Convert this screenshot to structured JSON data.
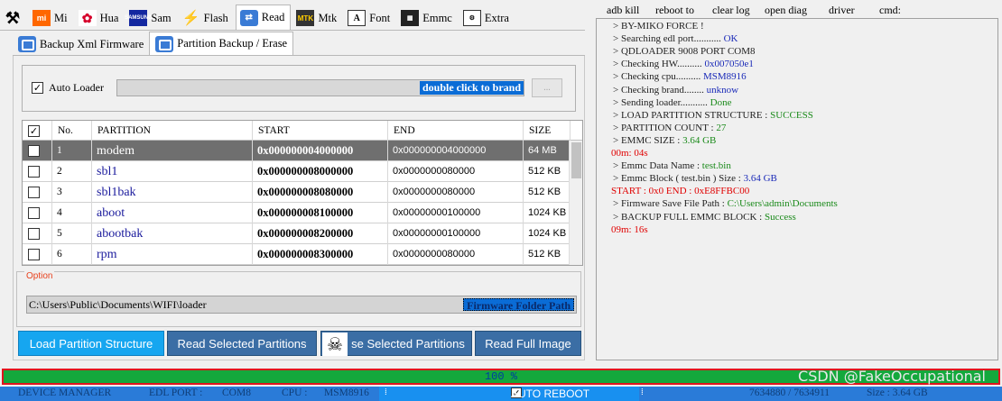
{
  "brand_tabs": [
    {
      "label": "",
      "icon": "tools-icon"
    },
    {
      "label": "Mi",
      "icon": "mi-icon"
    },
    {
      "label": "Hua",
      "icon": "huawei-icon"
    },
    {
      "label": "Sam",
      "icon": "samsung-icon"
    },
    {
      "label": "Flash",
      "icon": "flash-icon"
    },
    {
      "label": "Read",
      "icon": "read-icon",
      "active": true
    },
    {
      "label": "Mtk",
      "icon": "mtk-icon"
    },
    {
      "label": "Font",
      "icon": "font-icon"
    },
    {
      "label": "Emmc",
      "icon": "emmc-icon"
    },
    {
      "label": "Extra",
      "icon": "extra-icon"
    }
  ],
  "sub_tabs": [
    {
      "label": "Backup Xml Firmware"
    },
    {
      "label": "Partition Backup / Erase",
      "active": true
    }
  ],
  "loader": {
    "checkbox_label": "Auto Loader",
    "checked": true,
    "hint": "double click to brand",
    "button_label": "..."
  },
  "table": {
    "headers": [
      "No.",
      "PARTITION",
      "START",
      "END",
      "SIZE"
    ],
    "rows": [
      {
        "no": "1",
        "name": "modem",
        "start": "0x000000004000000",
        "end": "0x000000004000000",
        "size": "64 MB",
        "selected": true
      },
      {
        "no": "2",
        "name": "sbl1",
        "start": "0x000000008000000",
        "end": "0x0000000080000",
        "size": "512 KB"
      },
      {
        "no": "3",
        "name": "sbl1bak",
        "start": "0x000000008080000",
        "end": "0x0000000080000",
        "size": "512 KB"
      },
      {
        "no": "4",
        "name": "aboot",
        "start": "0x000000008100000",
        "end": "0x00000000100000",
        "size": "1024 KB"
      },
      {
        "no": "5",
        "name": "abootbak",
        "start": "0x000000008200000",
        "end": "0x00000000100000",
        "size": "1024 KB"
      },
      {
        "no": "6",
        "name": "rpm",
        "start": "0x000000008300000",
        "end": "0x0000000080000",
        "size": "512 KB"
      }
    ]
  },
  "option": {
    "label": "Option",
    "path": "C:\\Users\\Public\\Documents\\WIFI\\loader",
    "path_button": "Firmware Folder Path"
  },
  "actions": {
    "load": "Load Partition Structure",
    "read": "Read Selected Partitions",
    "erase": "se Selected Partitions",
    "read_full": "Read Full Image"
  },
  "tool_menu": [
    "adb kill",
    "reboot to",
    "clear log",
    "open diag",
    "driver",
    "cmd:"
  ],
  "log": [
    {
      "label": "> BY-MIKO FORCE !",
      "value": "",
      "color": ""
    },
    {
      "label": "> Searching edl port...........",
      "value": "OK",
      "color": "b"
    },
    {
      "label": "> QDLOADER 9008 PORT COM8",
      "value": "",
      "color": ""
    },
    {
      "label": "> Checking HW..........",
      "value": "0x007050e1",
      "color": "b"
    },
    {
      "label": "> Checking cpu..........",
      "value": "MSM8916",
      "color": "b"
    },
    {
      "label": "> Checking brand........",
      "value": "unknow",
      "color": "b"
    },
    {
      "label": "> Sending loader...........",
      "value": "Done",
      "color": "g"
    },
    {
      "label": "> LOAD PARTITION  STRUCTURE  :",
      "value": "SUCCESS",
      "color": "g"
    },
    {
      "label": "> PARTITION COUNT  :",
      "value": "27",
      "color": "g"
    },
    {
      "label": "> EMMC SIZE   :",
      "value": "3.64 GB",
      "color": "g"
    },
    {
      "label": "",
      "value": "00m: 04s",
      "color": "r"
    },
    {
      "label": "> Emmc Data Name  :",
      "value": "test.bin",
      "color": "g"
    },
    {
      "label": "> Emmc Block ( test.bin ) Size   :",
      "value": "3.64 GB",
      "color": "b"
    },
    {
      "label": "",
      "value": "START  :  0x0     END  :   0xE8FFBC00",
      "color": "r"
    },
    {
      "label": "> Firmware Save File  Path :",
      "value": "C:\\Users\\admin\\Documents",
      "color": "g"
    },
    {
      "label": "> BACKUP FULL EMMC BLOCK   :",
      "value": "Success",
      "color": "g"
    },
    {
      "label": "",
      "value": "09m: 16s",
      "color": "r"
    }
  ],
  "progress": {
    "text": "100 %",
    "fraction": 1.0,
    "watermark": "CSDN @FakeOccupational"
  },
  "status": {
    "device_manager": "DEVICE MANAGER",
    "edl_port_label": "EDL PORT :",
    "edl_port": "COM8",
    "cpu_label": "CPU :",
    "cpu": "MSM8916",
    "auto_reboot": "AUTO REBOOT",
    "auto_reboot_checked": true,
    "dots": "⁞",
    "sectors": "7634880   /  7634911",
    "size": "Size  :  3.64 GB"
  }
}
